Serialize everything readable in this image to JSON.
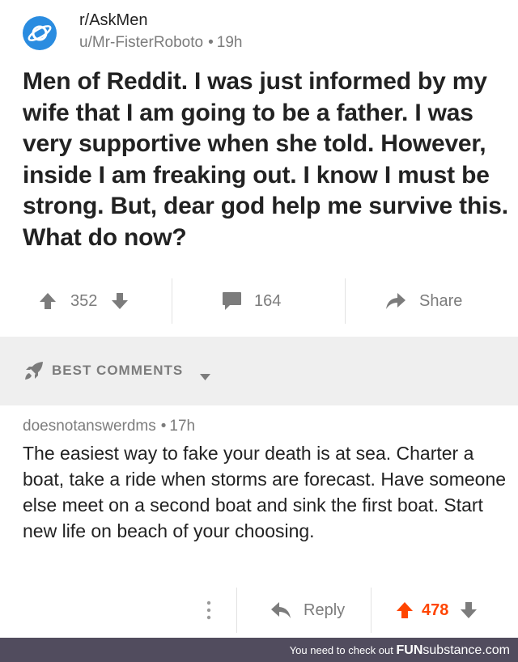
{
  "post": {
    "subreddit": "r/AskMen",
    "author": "u/Mr-FisterRoboto",
    "separator": "•",
    "age": "19h",
    "title": "Men of Reddit. I was just informed by my wife that I am going to be a father. I was very supportive when she told. However, inside I am freaking out. I know I must be strong. But, dear god help me survive this. What do now?",
    "score": "352",
    "comment_count": "164",
    "share_label": "Share"
  },
  "sort": {
    "label": "BEST COMMENTS"
  },
  "comment": {
    "author": "doesnotanswerdms",
    "separator": "•",
    "age": "17h",
    "body": "The easiest way to fake your death is at sea. Charter a boat, take a ride when storms are forecast. Have someone else meet on a second boat and sink the first boat. Start new life on beach of your choosing.",
    "reply_label": "Reply",
    "score": "478"
  },
  "footer": {
    "text": "You need to check out",
    "brand_main": "FUN",
    "brand_sub": "substance",
    "brand_tld": ".com"
  },
  "colors": {
    "subreddit_icon": "#2a8ce0",
    "upvoted": "#ff4500",
    "muted": "#7c7c7c",
    "sort_bar_bg": "#efefef",
    "footer_bg": "#514c5e"
  },
  "icons": [
    "subreddit-planet-icon",
    "upvote-arrow-icon",
    "downvote-arrow-icon",
    "comment-bubble-icon",
    "share-arrow-icon",
    "rocket-icon",
    "caret-down-icon",
    "more-options-icon",
    "reply-arrow-icon"
  ]
}
